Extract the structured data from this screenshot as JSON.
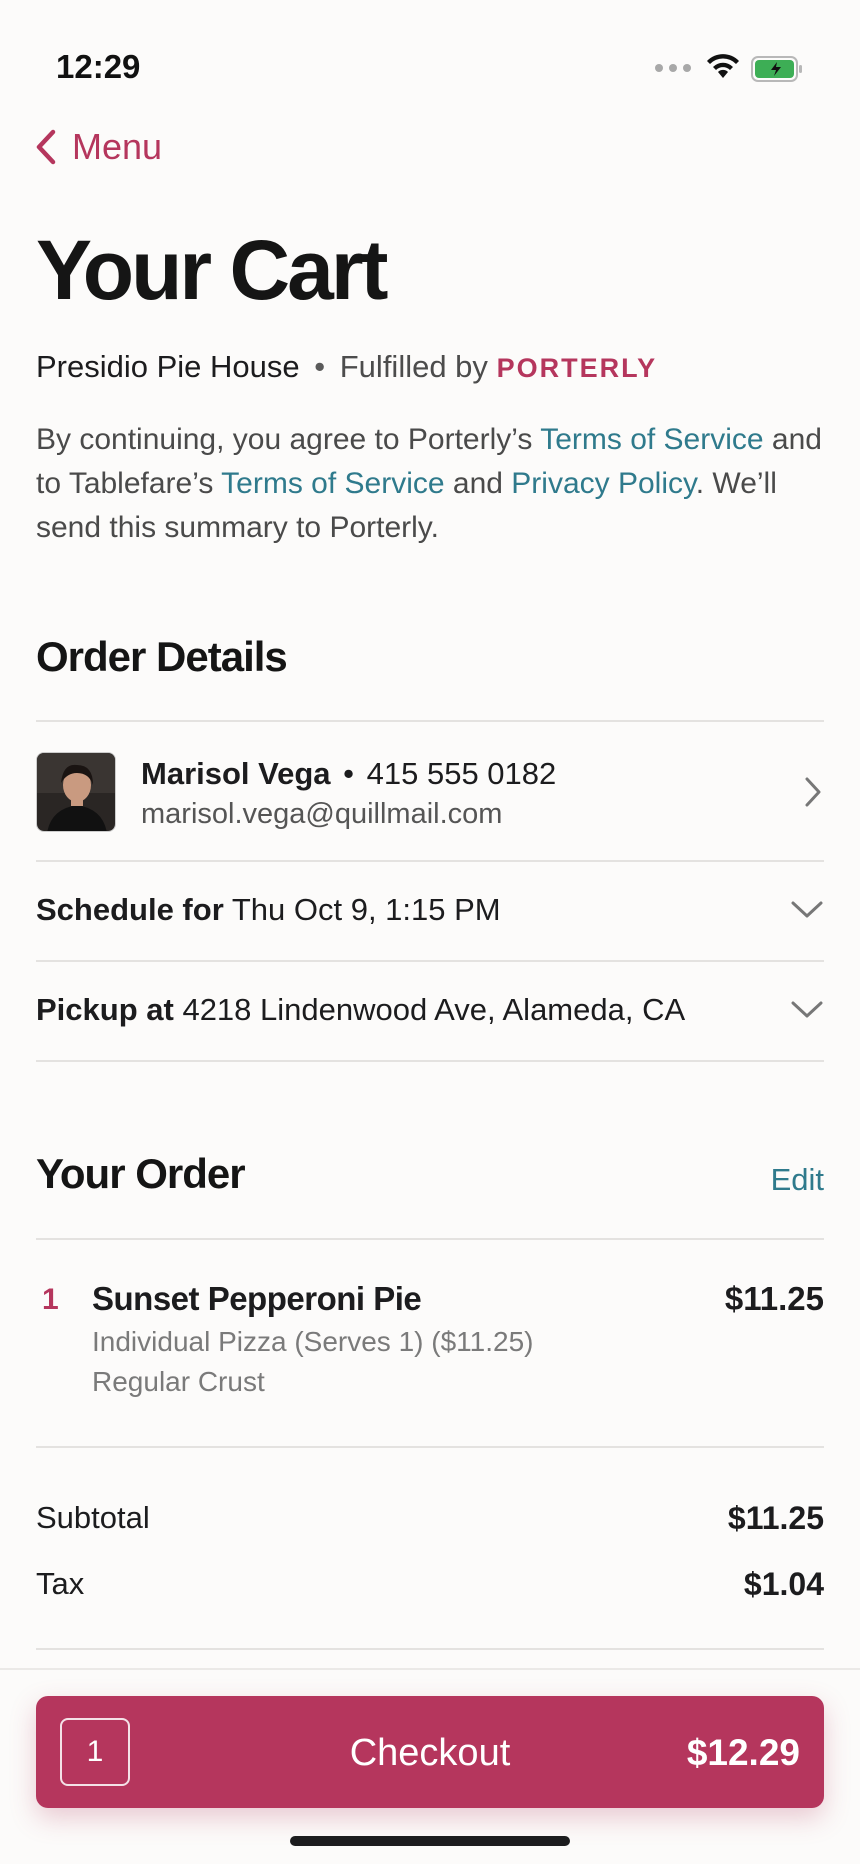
{
  "status_bar": {
    "time": "12:29"
  },
  "nav": {
    "back_label": "Menu"
  },
  "page": {
    "title": "Your Cart"
  },
  "store": {
    "name": "Presidio Pie House",
    "separator": "•",
    "fulfilled_by": "Fulfilled by",
    "courier": "PORTERLY"
  },
  "legal": {
    "part1": "By continuing, you agree to Porterly’s ",
    "link1": "Terms of Service",
    "part2": " and to Tablefare’s ",
    "link2": "Terms of Service",
    "part3": " and ",
    "link3": "Privacy Policy",
    "part4": ". We’ll send this summary to Porterly."
  },
  "order_details": {
    "title": "Order Details",
    "contact": {
      "name": "Marisol Vega",
      "separator": "•",
      "phone": "415 555 0182",
      "email": "marisol.vega@quillmail.com"
    },
    "schedule": {
      "label": "Schedule for",
      "value": "Thu Oct 9, 1:15 PM"
    },
    "pickup": {
      "label": "Pickup at",
      "value": "4218 Lindenwood Ave, Alameda, CA"
    }
  },
  "your_order": {
    "title": "Your Order",
    "edit_label": "Edit",
    "items": [
      {
        "qty": "1",
        "name": "Sunset Pepperoni Pie",
        "price": "$11.25",
        "options": [
          "Individual Pizza (Serves 1) ($11.25)",
          "Regular Crust"
        ]
      }
    ]
  },
  "summary": {
    "subtotal_label": "Subtotal",
    "subtotal_value": "$11.25",
    "tax_label": "Tax",
    "tax_value": "$1.04"
  },
  "checkout": {
    "count": "1",
    "label": "Checkout",
    "total": "$12.29"
  },
  "colors": {
    "accent": "#b5365d",
    "link": "#2f7a8c",
    "background": "#fcfbfa"
  }
}
